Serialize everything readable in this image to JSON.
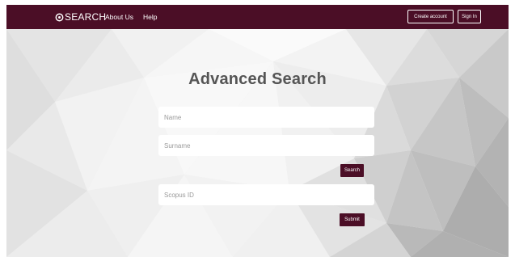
{
  "navbar": {
    "brand_label": "SEARCH",
    "brand_icon": "search-circle-icon",
    "links": [
      "About Us",
      "Help"
    ],
    "create_account_label": "Create account",
    "sign_in_label": "Sign In"
  },
  "main": {
    "title": "Advanced Search",
    "name_placeholder": "Name",
    "surname_placeholder": "Surname",
    "search_button_label": "Search",
    "scopus_placeholder": "Scopus ID",
    "submit_button_label": "Submit"
  },
  "colors": {
    "brand": "#4b0e26",
    "background": "#ededed",
    "title": "#555555"
  }
}
